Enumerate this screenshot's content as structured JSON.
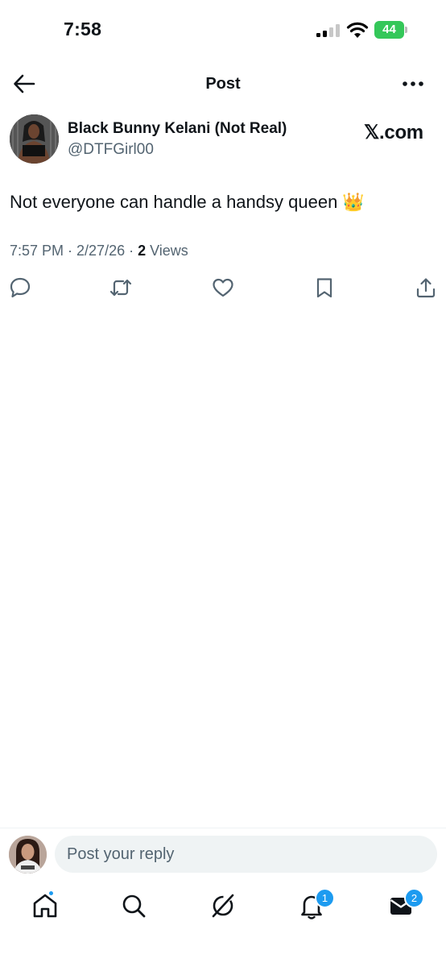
{
  "status_bar": {
    "time": "7:58",
    "battery_level": "44",
    "battery_charging": true,
    "signal_bars_active": 2,
    "signal_bars_total": 4
  },
  "nav": {
    "title": "Post"
  },
  "post": {
    "author_name": "Black Bunny Kelani (Not Real)",
    "author_handle": "@DTFGirl00",
    "source_label": "𝕏.com",
    "text": "Not everyone can handle a handsy queen 👑",
    "timestamp": "7:57 PM · 2/27/26 · ",
    "views_count": "2",
    "views_label": " Views"
  },
  "actions": [
    "reply-icon",
    "repost-icon",
    "like-icon",
    "bookmark-icon",
    "share-icon"
  ],
  "reply": {
    "placeholder": "Post your reply"
  },
  "tabs": {
    "notifications_badge": "1",
    "messages_badge": "2"
  },
  "colors": {
    "accent": "#1d9bf0",
    "text_primary": "#0f1419",
    "text_secondary": "#536471",
    "battery": "#34c759"
  }
}
